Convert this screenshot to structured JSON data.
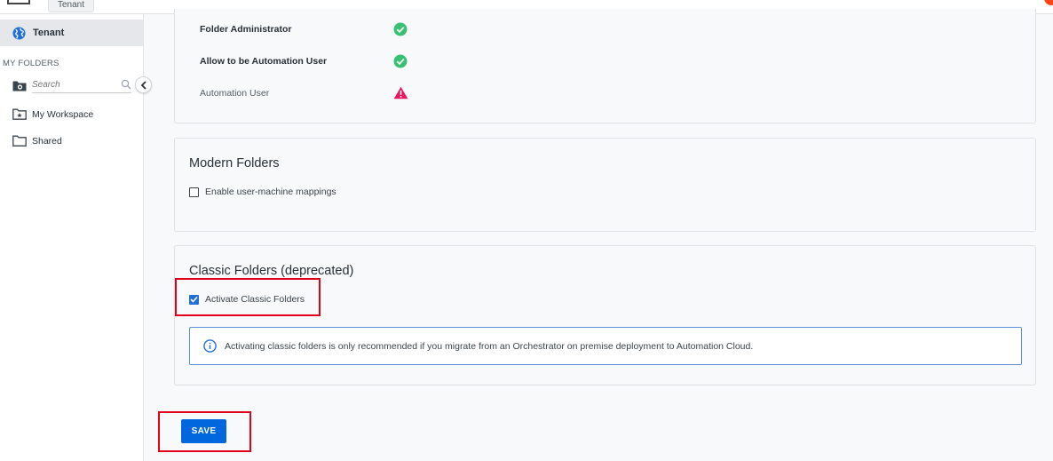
{
  "header": {
    "tooltip": "Tenant"
  },
  "sidebar": {
    "tenant_label": "Tenant",
    "section_label": "MY FOLDERS",
    "search_placeholder": "Search",
    "items": [
      {
        "label": "My Workspace",
        "icon": "folder-star-icon"
      },
      {
        "label": "Shared",
        "icon": "folder-icon"
      }
    ]
  },
  "permissions": [
    {
      "label": "Folder Administrator",
      "status": "check-circle-icon",
      "bold": true
    },
    {
      "label": "Allow to be Automation User",
      "status": "check-circle-icon",
      "bold": true
    },
    {
      "label": "Automation User",
      "status": "warning-triangle-icon",
      "bold": false
    }
  ],
  "modern_folders": {
    "title": "Modern Folders",
    "checkbox_label": "Enable user-machine mappings",
    "checked": false
  },
  "classic_folders": {
    "title": "Classic Folders (deprecated)",
    "checkbox_label": "Activate Classic Folders",
    "checked": true,
    "info_text": "Activating classic folders is only recommended if you migrate from an Orchestrator on premise deployment to Automation Cloud."
  },
  "actions": {
    "save_label": "SAVE"
  },
  "colors": {
    "primary": "#0067df",
    "success": "#38c172",
    "warning": "#e8175d",
    "highlight": "#e3001b"
  }
}
